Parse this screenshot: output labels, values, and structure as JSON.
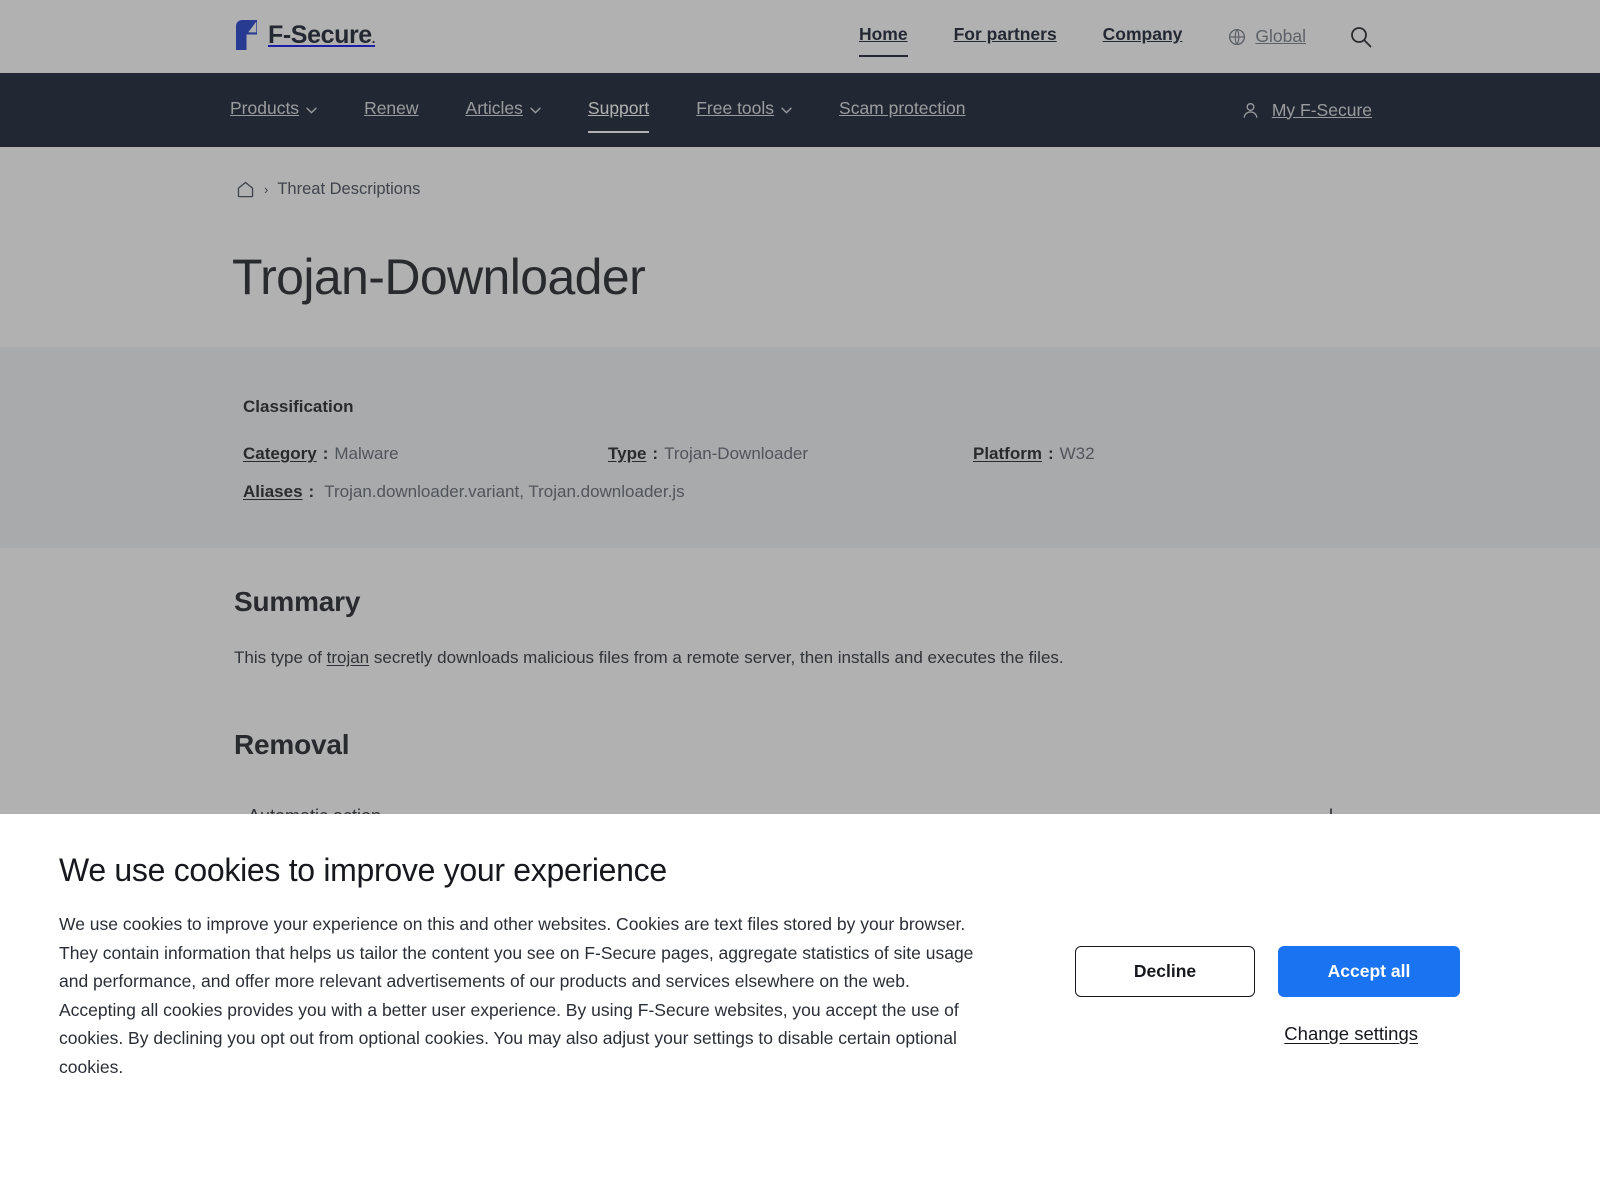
{
  "brand": {
    "name": "F-Secure",
    "registered_mark": ".",
    "logo_color": "#1434cb",
    "wordmark_color": "#0b1326"
  },
  "topbar": {
    "links": [
      {
        "label": "Home",
        "active": true
      },
      {
        "label": "For partners",
        "active": false
      },
      {
        "label": "Company",
        "active": false
      }
    ],
    "region": {
      "label": "Global",
      "icon": "globe-icon"
    },
    "search": {
      "icon": "search-icon"
    }
  },
  "mainnav": {
    "items": [
      {
        "label": "Products",
        "has_dropdown": true,
        "active": false
      },
      {
        "label": "Renew",
        "has_dropdown": false,
        "active": false
      },
      {
        "label": "Articles",
        "has_dropdown": true,
        "active": false
      },
      {
        "label": "Support",
        "has_dropdown": false,
        "active": true
      },
      {
        "label": "Free tools",
        "has_dropdown": true,
        "active": false
      },
      {
        "label": "Scam protection",
        "has_dropdown": false,
        "active": false
      }
    ],
    "account": {
      "label": "My F-Secure",
      "icon": "user-icon"
    },
    "background_color": "#0a1326"
  },
  "breadcrumb": {
    "home_icon": "home-icon",
    "separator": "›",
    "items": [
      "Threat Descriptions"
    ]
  },
  "page": {
    "title": "Trojan-Downloader"
  },
  "classification": {
    "heading": "Classification",
    "fields": [
      {
        "label": "Category",
        "separator": ":",
        "value": "Malware"
      },
      {
        "label": "Type",
        "separator": ":",
        "value": "Trojan-Downloader"
      },
      {
        "label": "Platform",
        "separator": ":",
        "value": "W32"
      },
      {
        "label": "Aliases",
        "separator": ":",
        "value": "Trojan.downloader.variant, Trojan.downloader.js"
      }
    ]
  },
  "summary": {
    "heading": "Summary",
    "text_before": "This type of ",
    "link": "trojan",
    "text_after": " secretly downloads malicious files from a remote server, then installs and executes the files."
  },
  "removal": {
    "heading": "Removal",
    "items": [
      {
        "label": "Automatic action",
        "expand_icon": "plus-icon",
        "expanded": false
      }
    ]
  },
  "cookie_banner": {
    "title": "We use cookies to improve your experience",
    "body": "We use cookies to improve your experience on this and other websites. Cookies are text files stored by your browser. They contain information that helps us tailor the content you see on F-Secure pages, aggregate statistics of site usage and performance, and offer more relevant advertisements of our products and services elsewhere on the web. Accepting all cookies provides you with a better user experience. By using F-Secure websites, you accept the use of cookies. By declining you opt out from optional cookies. You may also adjust your settings to disable certain optional cookies.",
    "decline_label": "Decline",
    "accept_label": "Accept all",
    "change_settings_label": "Change settings",
    "accent_color": "#1a74f2"
  }
}
